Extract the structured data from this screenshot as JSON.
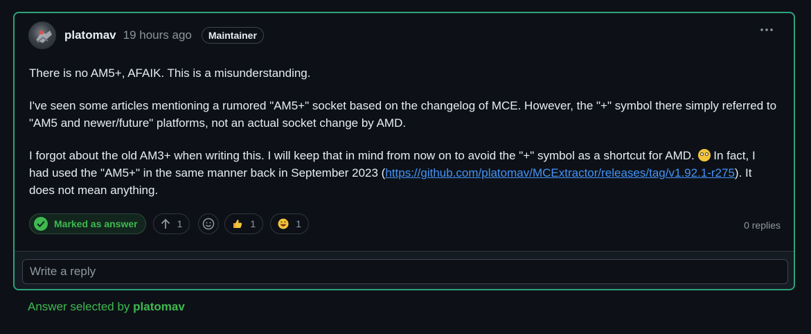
{
  "comment": {
    "author": "platomav",
    "timestamp": "19 hours ago",
    "role_badge": "Maintainer",
    "more_icon": "kebab-horizontal-icon",
    "paragraphs": {
      "p1": "There is no AM5+, AFAIK. This is a misunderstanding.",
      "p2": "I've seen some articles mentioning a rumored \"AM5+\" socket based on the changelog of MCE. However, the \"+\" symbol there simply referred to \"AM5 and newer/future\" platforms, not an actual socket change by AMD.",
      "p3_before_emoji": "I forgot about the old AM3+ when writing this. I will keep that in mind from now on to avoid the \"+\" symbol as a shortcut for AMD. ",
      "p3_emoji": "face-with-rolling-eyes",
      "p3_middle": " In fact, I had used the \"AM5+\" in the same manner back in September 2023 (",
      "p3_link": "https://github.com/platomav/MCExtractor/releases/tag/v1.92.1-r275",
      "p3_after": "). It does not mean anything."
    }
  },
  "reactions": {
    "answer_label": "Marked as answer",
    "upvote_count": "1",
    "thumbs_up_count": "1",
    "grinning_count": "1",
    "replies": "0 replies"
  },
  "reply": {
    "placeholder": "Write a reply"
  },
  "answer_selected": {
    "prefix": "Answer selected by",
    "user": "platomav"
  },
  "colors": {
    "accent_green": "#3fb950",
    "border_highlight": "#2ea37a",
    "link": "#4493f8"
  }
}
